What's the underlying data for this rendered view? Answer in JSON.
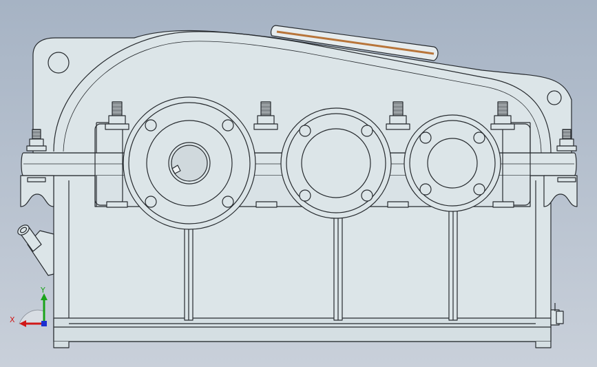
{
  "colors": {
    "body_fill": "#dce5e8",
    "body_stroke": "#262a2e",
    "bolt_dark": "#3a4045",
    "seal_strip": "#b8753a",
    "x_axis": "#d01818",
    "y_axis": "#19a319",
    "z_axis": "#1c2fd0"
  },
  "triad": {
    "x_label": "X",
    "y_label": "Y"
  }
}
